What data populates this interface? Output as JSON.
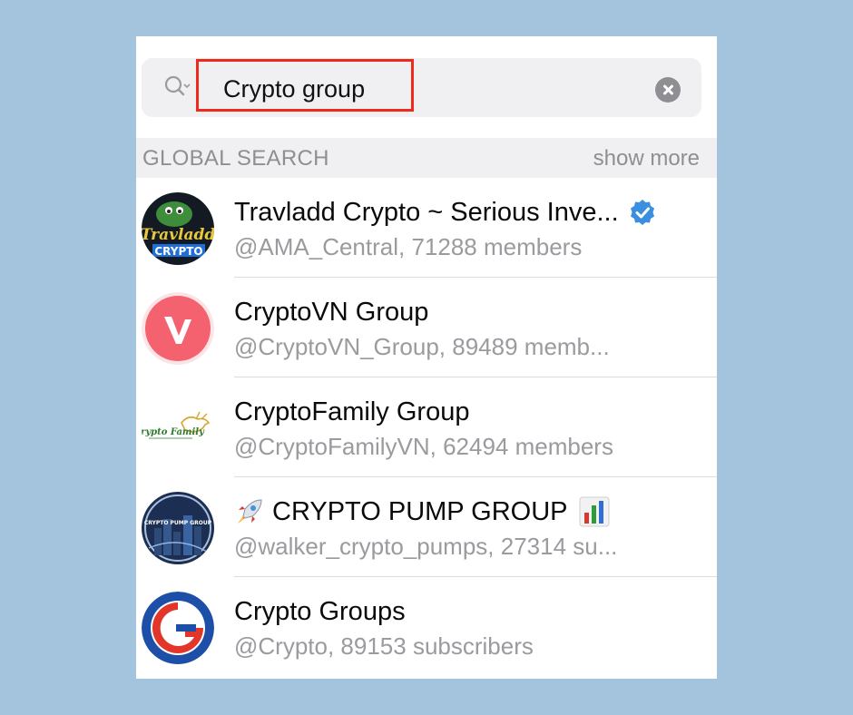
{
  "search": {
    "query": "Crypto group"
  },
  "section": {
    "title": "GLOBAL SEARCH",
    "show_more": "show more"
  },
  "results": [
    {
      "title": "Travladd Crypto ~ Serious Inve...",
      "subtitle": "@AMA_Central, 71288 members",
      "verified": true,
      "avatar_text": "Travladd CRYPTO",
      "avatar_icon": "frog-avatar"
    },
    {
      "title": "CryptoVN Group",
      "subtitle": "@CryptoVN_Group, 89489 memb...",
      "verified": false,
      "avatar_text": "V",
      "avatar_icon": "v-logo-avatar"
    },
    {
      "title": "CryptoFamily Group",
      "subtitle": "@CryptoFamilyVN, 62494 members",
      "verified": false,
      "avatar_text": "Crypto Family",
      "avatar_icon": "bull-logo-avatar"
    },
    {
      "title": "CRYPTO PUMP GROUP",
      "subtitle": "@walker_crypto_pumps, 27314 su...",
      "verified": false,
      "avatar_text": "CRYPTO PUMP GROUP",
      "avatar_icon": "city-night-avatar",
      "leading_icon": "rocket-icon",
      "trailing_icon": "bar-chart-icon"
    },
    {
      "title": "Crypto Groups",
      "subtitle": "@Crypto, 89153 subscribers",
      "verified": false,
      "avatar_icon": "cg-logo-avatar"
    }
  ],
  "colors": {
    "background": "#a3c4dc",
    "highlight": "#ee2a1c",
    "verified": "#3a8fe0",
    "secondary_text": "#9a9a9f"
  }
}
